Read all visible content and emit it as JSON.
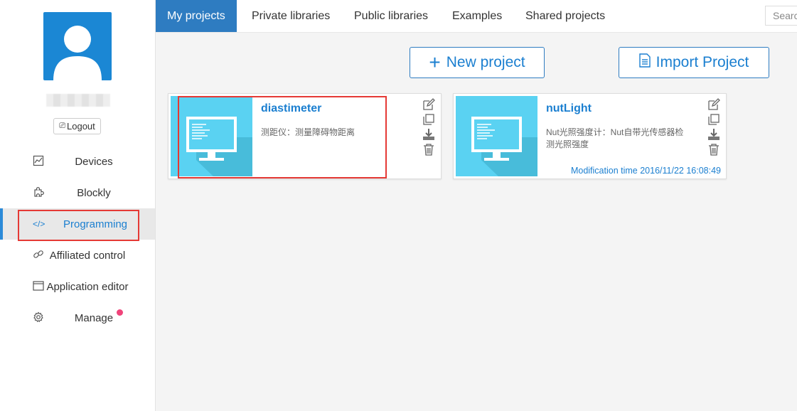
{
  "sidebar": {
    "logout_label": "Logout",
    "items": [
      {
        "label": "Devices",
        "icon": "chart-icon"
      },
      {
        "label": "Blockly",
        "icon": "puzzle-icon"
      },
      {
        "label": "Programming",
        "icon": "code-icon",
        "active": true
      },
      {
        "label": "Affiliated control",
        "icon": "link-icon"
      },
      {
        "label": "Application editor",
        "icon": "window-icon"
      },
      {
        "label": "Manage",
        "icon": "gear-icon",
        "notification": true
      }
    ]
  },
  "tabs": [
    {
      "label": "My projects",
      "active": true
    },
    {
      "label": "Private libraries"
    },
    {
      "label": "Public libraries"
    },
    {
      "label": "Examples"
    },
    {
      "label": "Shared projects"
    }
  ],
  "search": {
    "placeholder": "Search"
  },
  "actions": {
    "new_project": "New project",
    "import_project": "Import Project"
  },
  "projects": [
    {
      "title": "diastimeter",
      "description": "测距仪：测量障碍物距离",
      "time": ""
    },
    {
      "title": "nutLight",
      "description": "Nut光照强度计：Nut自带光传感器检测光照强度",
      "time": "Modification time 2016/11/22 16:08:49"
    }
  ],
  "colors": {
    "accent": "#1b7fd0",
    "tab_active": "#2e7cc1",
    "thumb": "#5ad2f2",
    "highlight": "#e53935",
    "badge": "#f0437a"
  }
}
